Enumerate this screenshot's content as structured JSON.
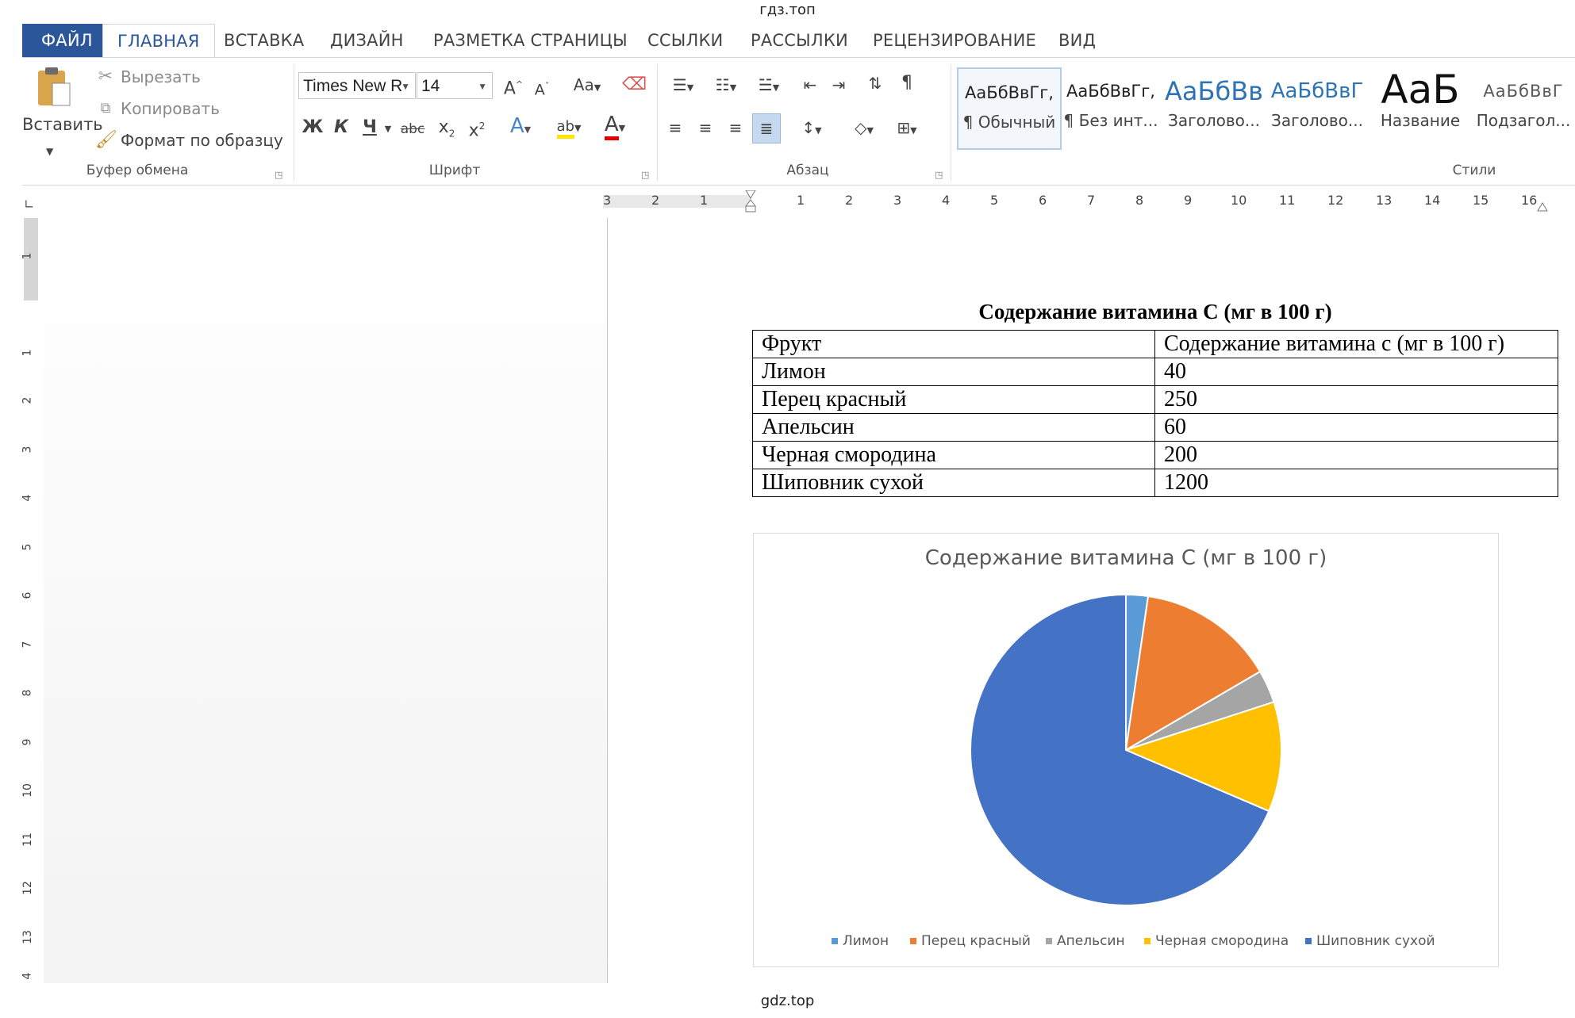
{
  "watermark_top": "гдз.топ",
  "watermark_bottom": "gdz.top",
  "tabs": [
    "ФАЙЛ",
    "ГЛАВНАЯ",
    "ВСТАВКА",
    "ДИЗАЙН",
    "РАЗМЕТКА СТРАНИЦЫ",
    "ССЫЛКИ",
    "РАССЫЛКИ",
    "РЕЦЕНЗИРОВАНИЕ",
    "ВИД"
  ],
  "clipboard": {
    "paste": "Вставить",
    "cut": "Вырезать",
    "copy": "Копировать",
    "format_painter": "Формат по образцу",
    "label": "Буфер обмена"
  },
  "font": {
    "name": "Times New R",
    "size": "14",
    "bold": "Ж",
    "italic": "К",
    "underline": "Ч",
    "strike": "abc",
    "label": "Шрифт"
  },
  "paragraph": {
    "label": "Абзац"
  },
  "styles": {
    "label": "Стили",
    "items": [
      {
        "sample": "АаБбВвГг,",
        "name": "¶ Обычный"
      },
      {
        "sample": "АаБбВвГг,",
        "name": "¶ Без инт..."
      },
      {
        "sample": "АаБбВв",
        "name": "Заголово..."
      },
      {
        "sample": "АаБбВвГ",
        "name": "Заголово..."
      },
      {
        "sample": "АаБ",
        "name": "Название"
      },
      {
        "sample": "АаБбВвГ",
        "name": "Подзагол..."
      }
    ]
  },
  "ruler": {
    "h_marks": [
      "3",
      "2",
      "1",
      "1",
      "2",
      "3",
      "4",
      "5",
      "6",
      "7",
      "8",
      "9",
      "10",
      "11",
      "12",
      "13",
      "14",
      "15",
      "16"
    ],
    "v_marks": [
      "1",
      "1",
      "2",
      "3",
      "4",
      "5",
      "6",
      "7",
      "8",
      "9",
      "10",
      "11",
      "12",
      "13",
      "4"
    ]
  },
  "document": {
    "title": "Содержание витамина С (мг в 100 г)",
    "table": {
      "header": [
        "Фрукт",
        "Содержание витамина с (мг в 100 г)"
      ],
      "rows": [
        [
          "Лимон",
          "40"
        ],
        [
          "Перец красный",
          "250"
        ],
        [
          "Апельсин",
          "60"
        ],
        [
          "Черная смородина",
          "200"
        ],
        [
          "Шиповник сухой",
          "1200"
        ]
      ]
    }
  },
  "colors": {
    "word_blue": "#2b579a",
    "lemon": "#5b9bd5",
    "pepper": "#ed7d31",
    "orange": "#a5a5a5",
    "currant": "#ffc000",
    "rosehip": "#4472c4"
  },
  "chart_data": {
    "type": "pie",
    "title": "Содержание витамина С (мг в 100 г)",
    "categories": [
      "Лимон",
      "Перец красный",
      "Апельсин",
      "Черная смородина",
      "Шиповник сухой"
    ],
    "values": [
      40,
      250,
      60,
      200,
      1200
    ],
    "legend": "bottom"
  }
}
